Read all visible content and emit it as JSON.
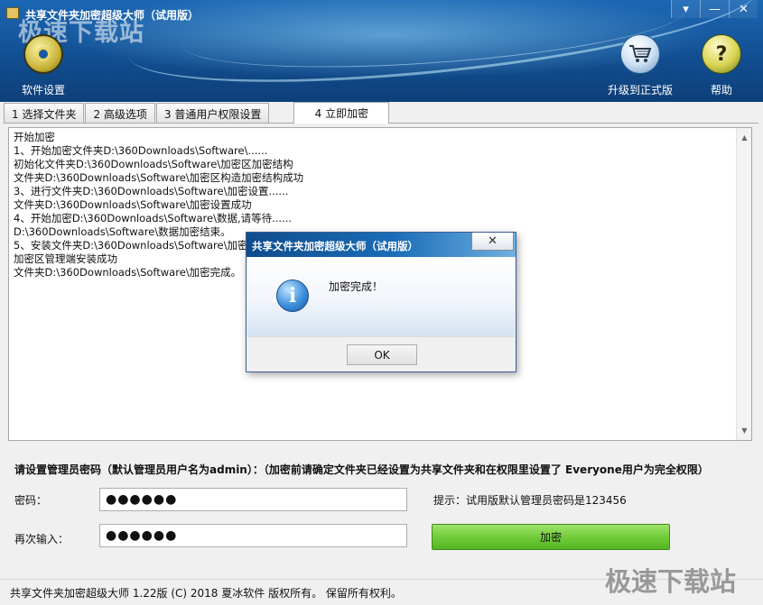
{
  "window": {
    "title": "共享文件夹加密超级大师（试用版）",
    "watermark_top": "极速下载站",
    "controls": {
      "dropdown": "▾",
      "minimize": "—",
      "close": "✕"
    }
  },
  "toolbar": {
    "settings_label": "软件设置",
    "upgrade_label": "升级到正式版",
    "help_label": "帮助",
    "help_glyph": "?"
  },
  "tabs": [
    {
      "label": "1 选择文件夹",
      "active": false
    },
    {
      "label": "2 高级选项",
      "active": false
    },
    {
      "label": "3 普通用户权限设置",
      "active": false
    },
    {
      "label": "4 立即加密",
      "active": true
    }
  ],
  "log": {
    "lines": [
      "开始加密",
      "1、开始加密文件夹D:\\360Downloads\\Software\\......",
      "初始化文件夹D:\\360Downloads\\Software\\加密区加密结构",
      "文件夹D:\\360Downloads\\Software\\加密区构造加密结构成功",
      "3、进行文件夹D:\\360Downloads\\Software\\加密设置......",
      "文件夹D:\\360Downloads\\Software\\加密设置成功",
      "4、开始加密D:\\360Downloads\\Software\\数据,请等待......",
      "D:\\360Downloads\\Software\\数据加密结束。",
      "5、安装文件夹D:\\360Downloads\\Software\\加密加",
      "加密区管理端安装成功",
      "文件夹D:\\360Downloads\\Software\\加密完成。"
    ]
  },
  "form": {
    "notice": "请设置管理员密码（默认管理员用户名为admin）：（加密前请确定文件夹已经设置为共享文件夹和在权限里设置了 Everyone用户为完全权限）",
    "password_label": "密码：",
    "password_value": "●●●●●●",
    "confirm_label": "再次输入：",
    "confirm_value": "●●●●●●",
    "hint": "提示：试用版默认管理员密码是123456",
    "encrypt_button": "加密"
  },
  "status": {
    "text": "共享文件夹加密超级大师 1.22版 (C) 2018 夏冰软件 版权所有。 保留所有权利。",
    "watermark": "极速下载站"
  },
  "dialog": {
    "title": "共享文件夹加密超级大师（试用版）",
    "message": "加密完成！",
    "ok_label": "OK",
    "close_glyph": "✕",
    "info_glyph": "i"
  }
}
